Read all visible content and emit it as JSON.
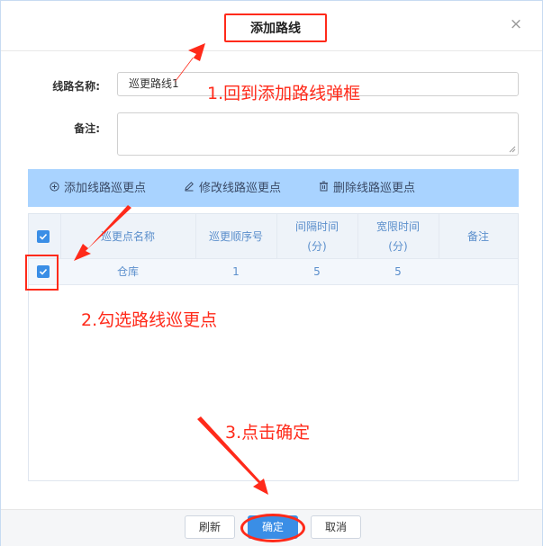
{
  "dialog": {
    "title": "添加路线",
    "close_glyph": "×"
  },
  "form": {
    "route_name_label": "线路名称:",
    "route_name_value": "巡更路线1",
    "remark_label": "备注:",
    "remark_value": ""
  },
  "toolbar": {
    "add_label": "添加线路巡更点",
    "edit_label": "修改线路巡更点",
    "delete_label": "删除线路巡更点",
    "add_icon": "plus-circle-icon",
    "edit_icon": "pencil-icon",
    "delete_icon": "trash-icon"
  },
  "table": {
    "headers": [
      "巡更点名称",
      "巡更顺序号",
      "间隔时间\n(分)",
      "宽限时间\n(分)",
      "备注"
    ],
    "rows": [
      {
        "name": "仓库",
        "order": "1",
        "interval": "5",
        "grace": "5",
        "remark": "",
        "checked": true
      }
    ],
    "header_checked": true
  },
  "footer": {
    "refresh_label": "刷新",
    "ok_label": "确定",
    "cancel_label": "取消"
  },
  "annotations": {
    "step1": "1.回到添加路线弹框",
    "step2": "2.勾选路线巡更点",
    "step3": "3.点击确定"
  },
  "colors": {
    "accent": "#3a8ee6",
    "toolbar_bg": "#a9d3ff",
    "annotation_red": "#ff2a1a",
    "table_text": "#5b8fcc"
  }
}
